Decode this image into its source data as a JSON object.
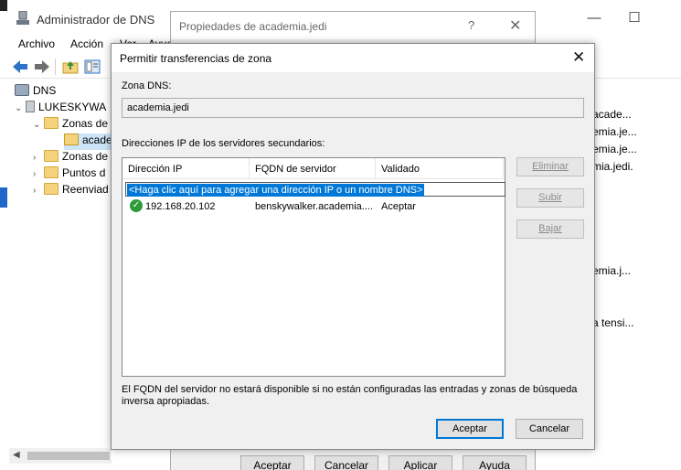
{
  "dns_manager": {
    "title": "Administrador de DNS",
    "window_controls": {
      "minimize": "—",
      "maximize": "☐"
    },
    "menu": [
      "Archivo",
      "Acción",
      "Ver",
      "Ayuda"
    ],
    "tree": {
      "root": "DNS",
      "server": "LUKESKYWA",
      "zonas_directas": "Zonas de",
      "zona_seleccionada": "acade",
      "zonas_inversas": "Zonas de",
      "puntos": "Puntos d",
      "reenviadores": "Reenviad"
    },
    "right_items": [
      "acade...",
      "emia.je...",
      "emia.je...",
      "mia.jedi.",
      "emia.j...",
      "a tensi..."
    ]
  },
  "properties": {
    "title": "Propiedades de academia.jedi",
    "help": "?",
    "close": "✕",
    "buttons": {
      "accept": "Aceptar",
      "cancel": "Cancelar",
      "apply": "Aplicar",
      "help": "Ayuda"
    }
  },
  "dialog": {
    "title": "Permitir transferencias de zona",
    "close": "✕",
    "zone_label": "Zona DNS:",
    "zone_value": "academia.jedi",
    "servers_label": "Direcciones IP de los servidores secundarios:",
    "columns": [
      "Dirección IP",
      "FQDN de servidor",
      "Validado"
    ],
    "add_placeholder": "<Haga clic aquí para agregar una dirección IP o un nombre DNS>",
    "rows": [
      {
        "ip": "192.168.20.102",
        "fqdn": "benskywalker.academia....",
        "validated": "Aceptar"
      }
    ],
    "side_buttons": {
      "delete": "Eliminar",
      "up": "Subir",
      "down": "Bajar"
    },
    "note": "El FQDN del servidor no estará disponible si no están configuradas las entradas y zonas de búsqueda inversa apropiadas.",
    "ok": "Aceptar",
    "cancel": "Cancelar"
  }
}
